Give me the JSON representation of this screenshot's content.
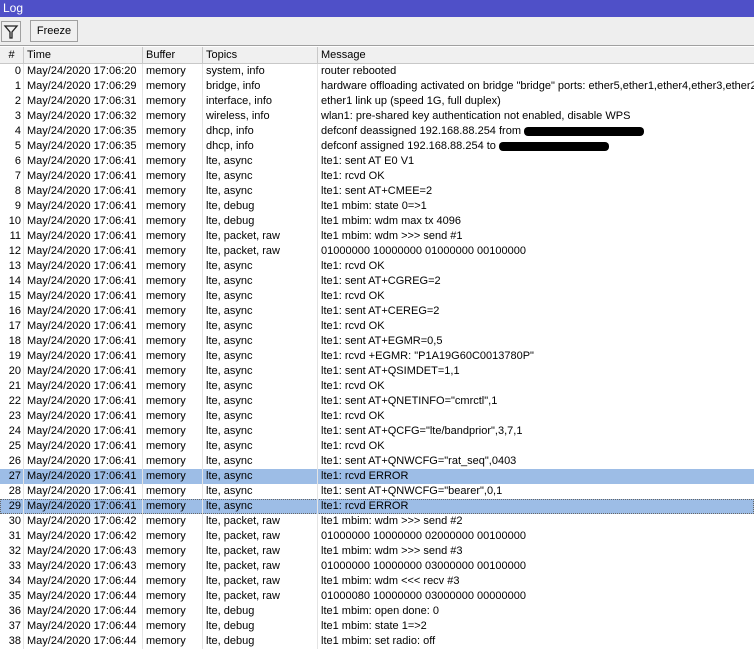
{
  "window": {
    "title": "Log"
  },
  "toolbar": {
    "filter_icon": "filter-funnel-icon",
    "freeze_label": "Freeze"
  },
  "columns": [
    "#",
    "Time",
    "Buffer",
    "Topics",
    "Message"
  ],
  "selection_color": "#9dbde6",
  "title_color": "#4f50c8",
  "rows": [
    {
      "n": "0",
      "time": "May/24/2020 17:06:20",
      "buffer": "memory",
      "topics": "system, info",
      "message": "router rebooted"
    },
    {
      "n": "1",
      "time": "May/24/2020 17:06:29",
      "buffer": "memory",
      "topics": "bridge, info",
      "message": "hardware offloading activated on bridge \"bridge\" ports: ether5,ether1,ether4,ether3,ether2"
    },
    {
      "n": "2",
      "time": "May/24/2020 17:06:31",
      "buffer": "memory",
      "topics": "interface, info",
      "message": "ether1 link up (speed 1G, full duplex)"
    },
    {
      "n": "3",
      "time": "May/24/2020 17:06:32",
      "buffer": "memory",
      "topics": "wireless, info",
      "message": "wlan1: pre-shared key authentication not enabled, disable WPS"
    },
    {
      "n": "4",
      "time": "May/24/2020 17:06:35",
      "buffer": "memory",
      "topics": "dhcp, info",
      "message": "defconf deassigned 192.168.88.254 from",
      "redacted": true
    },
    {
      "n": "5",
      "time": "May/24/2020 17:06:35",
      "buffer": "memory",
      "topics": "dhcp, info",
      "message": "defconf assigned 192.168.88.254 to",
      "redacted": true
    },
    {
      "n": "6",
      "time": "May/24/2020 17:06:41",
      "buffer": "memory",
      "topics": "lte, async",
      "message": "lte1: sent AT E0 V1"
    },
    {
      "n": "7",
      "time": "May/24/2020 17:06:41",
      "buffer": "memory",
      "topics": "lte, async",
      "message": "lte1: rcvd OK"
    },
    {
      "n": "8",
      "time": "May/24/2020 17:06:41",
      "buffer": "memory",
      "topics": "lte, async",
      "message": "lte1: sent AT+CMEE=2"
    },
    {
      "n": "9",
      "time": "May/24/2020 17:06:41",
      "buffer": "memory",
      "topics": "lte, debug",
      "message": "lte1 mbim: state 0=>1"
    },
    {
      "n": "10",
      "time": "May/24/2020 17:06:41",
      "buffer": "memory",
      "topics": "lte, debug",
      "message": "lte1 mbim: wdm max tx 4096"
    },
    {
      "n": "11",
      "time": "May/24/2020 17:06:41",
      "buffer": "memory",
      "topics": "lte, packet, raw",
      "message": "lte1 mbim: wdm >>> send #1"
    },
    {
      "n": "12",
      "time": "May/24/2020 17:06:41",
      "buffer": "memory",
      "topics": "lte, packet, raw",
      "message": "01000000 10000000 01000000 00100000"
    },
    {
      "n": "13",
      "time": "May/24/2020 17:06:41",
      "buffer": "memory",
      "topics": "lte, async",
      "message": "lte1: rcvd OK"
    },
    {
      "n": "14",
      "time": "May/24/2020 17:06:41",
      "buffer": "memory",
      "topics": "lte, async",
      "message": "lte1: sent AT+CGREG=2"
    },
    {
      "n": "15",
      "time": "May/24/2020 17:06:41",
      "buffer": "memory",
      "topics": "lte, async",
      "message": "lte1: rcvd OK"
    },
    {
      "n": "16",
      "time": "May/24/2020 17:06:41",
      "buffer": "memory",
      "topics": "lte, async",
      "message": "lte1: sent AT+CEREG=2"
    },
    {
      "n": "17",
      "time": "May/24/2020 17:06:41",
      "buffer": "memory",
      "topics": "lte, async",
      "message": "lte1: rcvd OK"
    },
    {
      "n": "18",
      "time": "May/24/2020 17:06:41",
      "buffer": "memory",
      "topics": "lte, async",
      "message": "lte1: sent AT+EGMR=0,5"
    },
    {
      "n": "19",
      "time": "May/24/2020 17:06:41",
      "buffer": "memory",
      "topics": "lte, async",
      "message": "lte1: rcvd +EGMR: \"P1A19G60C0013780P\""
    },
    {
      "n": "20",
      "time": "May/24/2020 17:06:41",
      "buffer": "memory",
      "topics": "lte, async",
      "message": "lte1: sent AT+QSIMDET=1,1"
    },
    {
      "n": "21",
      "time": "May/24/2020 17:06:41",
      "buffer": "memory",
      "topics": "lte, async",
      "message": "lte1: rcvd OK"
    },
    {
      "n": "22",
      "time": "May/24/2020 17:06:41",
      "buffer": "memory",
      "topics": "lte, async",
      "message": "lte1: sent AT+QNETINFO=\"cmrctl\",1"
    },
    {
      "n": "23",
      "time": "May/24/2020 17:06:41",
      "buffer": "memory",
      "topics": "lte, async",
      "message": "lte1: rcvd OK"
    },
    {
      "n": "24",
      "time": "May/24/2020 17:06:41",
      "buffer": "memory",
      "topics": "lte, async",
      "message": "lte1: sent AT+QCFG=\"lte/bandprior\",3,7,1"
    },
    {
      "n": "25",
      "time": "May/24/2020 17:06:41",
      "buffer": "memory",
      "topics": "lte, async",
      "message": "lte1: rcvd OK"
    },
    {
      "n": "26",
      "time": "May/24/2020 17:06:41",
      "buffer": "memory",
      "topics": "lte, async",
      "message": "lte1: sent AT+QNWCFG=\"rat_seq\",0403"
    },
    {
      "n": "27",
      "time": "May/24/2020 17:06:41",
      "buffer": "memory",
      "topics": "lte, async",
      "message": "lte1: rcvd ERROR",
      "selected": true
    },
    {
      "n": "28",
      "time": "May/24/2020 17:06:41",
      "buffer": "memory",
      "topics": "lte, async",
      "message": "lte1: sent AT+QNWCFG=\"bearer\",0,1"
    },
    {
      "n": "29",
      "time": "May/24/2020 17:06:41",
      "buffer": "memory",
      "topics": "lte, async",
      "message": "lte1: rcvd ERROR",
      "selected": true,
      "focused": true
    },
    {
      "n": "30",
      "time": "May/24/2020 17:06:42",
      "buffer": "memory",
      "topics": "lte, packet, raw",
      "message": "lte1 mbim: wdm >>> send #2"
    },
    {
      "n": "31",
      "time": "May/24/2020 17:06:42",
      "buffer": "memory",
      "topics": "lte, packet, raw",
      "message": "01000000 10000000 02000000 00100000"
    },
    {
      "n": "32",
      "time": "May/24/2020 17:06:43",
      "buffer": "memory",
      "topics": "lte, packet, raw",
      "message": "lte1 mbim: wdm >>> send #3"
    },
    {
      "n": "33",
      "time": "May/24/2020 17:06:43",
      "buffer": "memory",
      "topics": "lte, packet, raw",
      "message": "01000000 10000000 03000000 00100000"
    },
    {
      "n": "34",
      "time": "May/24/2020 17:06:44",
      "buffer": "memory",
      "topics": "lte, packet, raw",
      "message": "lte1 mbim: wdm <<< recv #3"
    },
    {
      "n": "35",
      "time": "May/24/2020 17:06:44",
      "buffer": "memory",
      "topics": "lte, packet, raw",
      "message": "01000080 10000000 03000000 00000000"
    },
    {
      "n": "36",
      "time": "May/24/2020 17:06:44",
      "buffer": "memory",
      "topics": "lte, debug",
      "message": "lte1 mbim: open done: 0"
    },
    {
      "n": "37",
      "time": "May/24/2020 17:06:44",
      "buffer": "memory",
      "topics": "lte, debug",
      "message": "lte1 mbim: state 1=>2"
    },
    {
      "n": "38",
      "time": "May/24/2020 17:06:44",
      "buffer": "memory",
      "topics": "lte, debug",
      "message": "lte1 mbim: set radio: off"
    }
  ]
}
